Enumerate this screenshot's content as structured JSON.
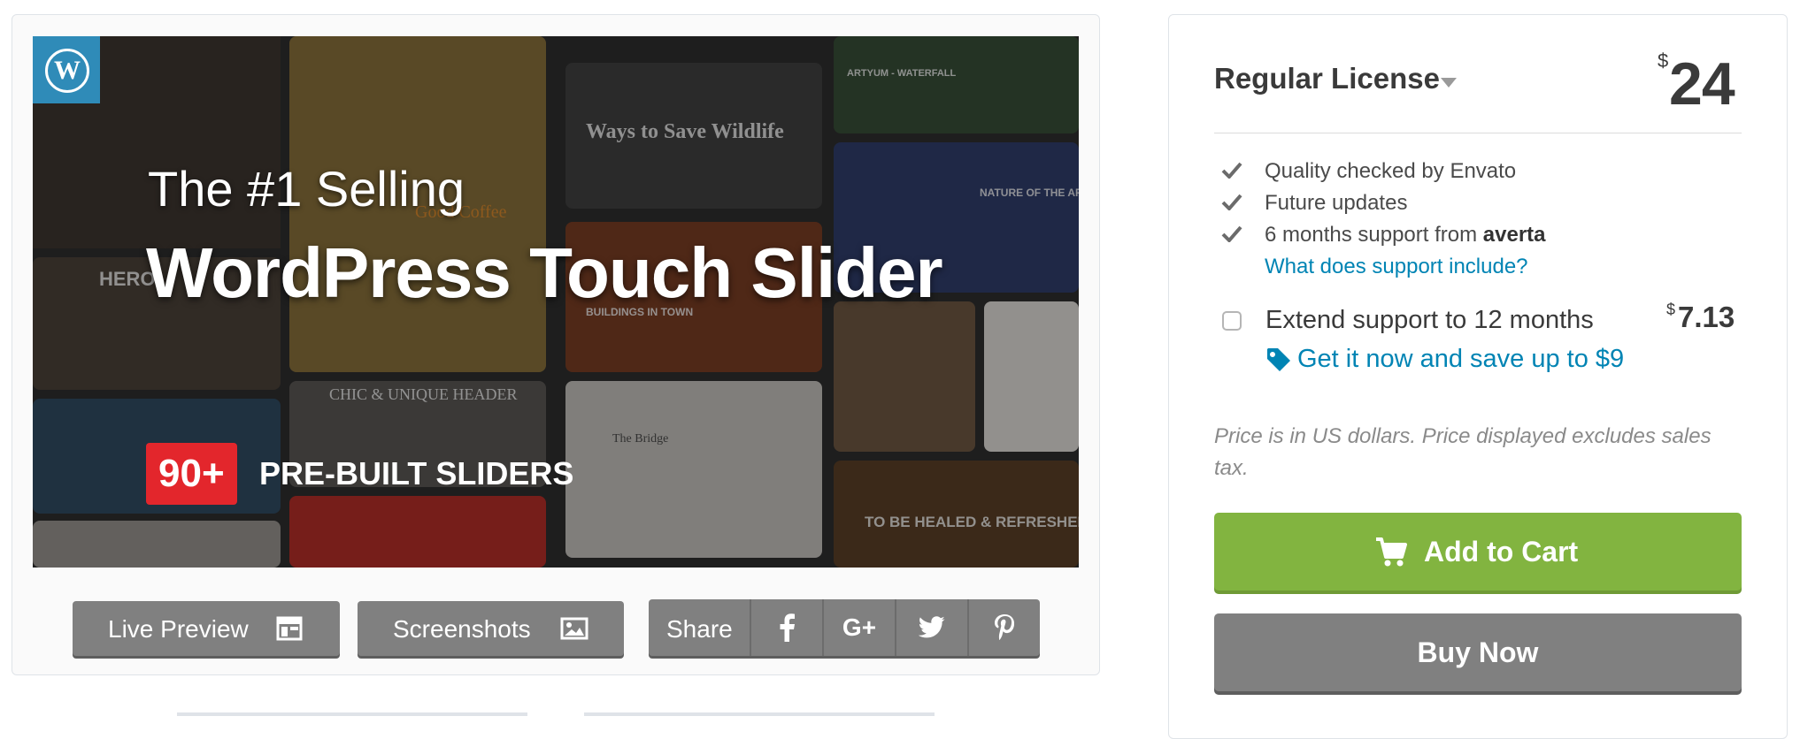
{
  "preview": {
    "hero": {
      "tagline": "The #1 Selling",
      "title": "WordPress Touch Slider",
      "badge": "90+",
      "badge_text": "PRE-BUILT SLIDERS",
      "tile_texts": [
        "Ways to Save Wildlife",
        "CHIC & UNIQUE HEADER",
        "TO BE HEALED & REFRESHED",
        "NATURE OF THE ARTIST",
        "HERO",
        "The Bridge",
        "ARTYUM - WATERFALL",
        "BUILDINGS IN TOWN",
        "Good Coffee"
      ]
    },
    "buttons": {
      "live_preview": "Live Preview",
      "screenshots": "Screenshots",
      "share": "Share"
    },
    "social_icons": [
      "facebook-icon",
      "google-plus-icon",
      "twitter-icon",
      "pinterest-icon"
    ]
  },
  "purchase": {
    "license_name": "Regular License",
    "currency_symbol": "$",
    "price": "24",
    "features": [
      {
        "text": "Quality checked by Envato"
      },
      {
        "text": "Future updates"
      },
      {
        "text_prefix": "6 months support from ",
        "author": "averta"
      }
    ],
    "support_link": "What does support include?",
    "extend_label": "Extend support to 12 months",
    "extend_currency": "$",
    "extend_price": "7.13",
    "extend_checked": false,
    "save_link": "Get it now and save up to $9",
    "price_note": "Price is in US dollars. Price displayed excludes sales tax.",
    "add_to_cart": "Add to Cart",
    "buy_now": "Buy Now"
  },
  "colors": {
    "accent_green": "#82b440",
    "link_blue": "#0084b4",
    "button_gray": "#808080",
    "badge_red": "#e3262c",
    "wordpress_blue": "#2f8bb8"
  }
}
